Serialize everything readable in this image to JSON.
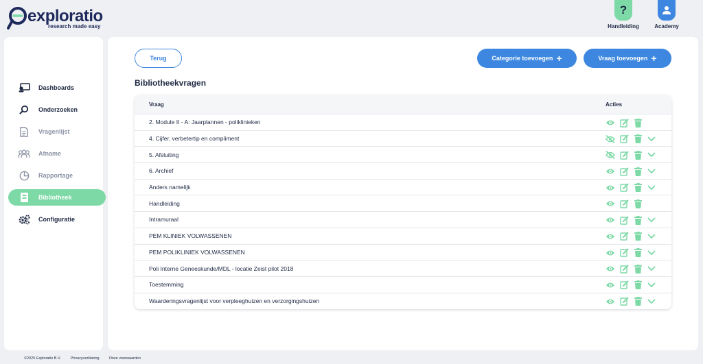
{
  "brand": {
    "name": "exploratio",
    "tagline": "research made easy"
  },
  "header": {
    "help_label": "Handleiding",
    "academy_label": "Academy"
  },
  "sidebar": {
    "items": [
      {
        "label": "Dashboards",
        "icon": "dashboard-icon",
        "state": "dark"
      },
      {
        "label": "Onderzoeken",
        "icon": "search-icon",
        "state": "dark"
      },
      {
        "label": "Vragenlijst",
        "icon": "document-icon",
        "state": "gray"
      },
      {
        "label": "Afname",
        "icon": "people-icon",
        "state": "gray"
      },
      {
        "label": "Rapportage",
        "icon": "pie-chart-icon",
        "state": "gray"
      },
      {
        "label": "Bibliotheek",
        "icon": "book-icon",
        "state": "active"
      },
      {
        "label": "Configuratie",
        "icon": "gears-icon",
        "state": "dark"
      }
    ]
  },
  "toolbar": {
    "back_label": "Terug",
    "add_category_label": "Categorie toevoegen",
    "add_question_label": "Vraag toevoegen"
  },
  "page_title": "Bibliotheekvragen",
  "table": {
    "columns": [
      "Vraag",
      "Acties"
    ],
    "rows": [
      {
        "vraag": "2. Module II - A: Jaarplannen - poliklinieken",
        "visible": true,
        "expandable": false
      },
      {
        "vraag": "4. Cijfer, verbetertip en compliment",
        "visible": false,
        "expandable": true
      },
      {
        "vraag": "5. Afsluiting",
        "visible": false,
        "expandable": true
      },
      {
        "vraag": "6. Archief",
        "visible": true,
        "expandable": true
      },
      {
        "vraag": "Anders namelijk",
        "visible": true,
        "expandable": true
      },
      {
        "vraag": "Handleiding",
        "visible": true,
        "expandable": false
      },
      {
        "vraag": "Intramuraal",
        "visible": true,
        "expandable": true
      },
      {
        "vraag": "PEM KLINIEK VOLWASSENEN",
        "visible": true,
        "expandable": true
      },
      {
        "vraag": "PEM POLIKLINIEK VOLWASSENEN",
        "visible": true,
        "expandable": true
      },
      {
        "vraag": "Poli Interne Geneeskunde/MDL - locatie Zeist pilot 2018",
        "visible": true,
        "expandable": true
      },
      {
        "vraag": "Toestemming",
        "visible": true,
        "expandable": true
      },
      {
        "vraag": "Waarderingsvragenlijst voor verpleeghuizen en verzorgingshuizen",
        "visible": true,
        "expandable": true
      }
    ]
  },
  "footer": {
    "copyright": "©2025 Exploratio B.V.",
    "privacy": "Privacyverklaring",
    "terms": "Onze voorwaarden"
  },
  "colors": {
    "accent_green": "#7dd9a5",
    "accent_blue": "#3d87e0",
    "navy": "#1f2a44"
  }
}
